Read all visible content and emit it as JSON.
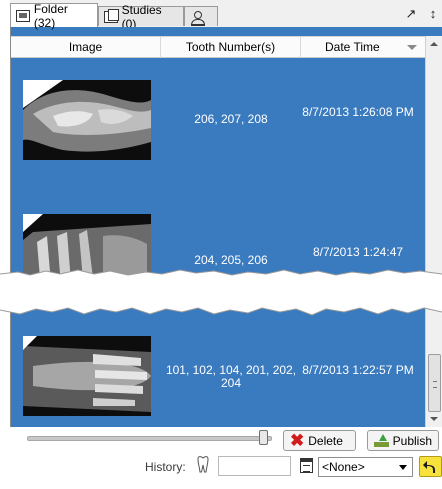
{
  "tabs": [
    {
      "label": "Folder (32)",
      "icon": "folder-icon",
      "active": true
    },
    {
      "label": "Studies (0)",
      "icon": "studies-icon",
      "active": false
    },
    {
      "label": "",
      "icon": "person-icon",
      "active": false
    }
  ],
  "grid": {
    "columns": [
      "Image",
      "Tooth Number(s)",
      "Date Time"
    ],
    "sort_column": "Date Time",
    "sort_direction": "descending",
    "row_color": "#3a7abf",
    "rows": [
      {
        "tooth_numbers": "206, 207, 208",
        "date_time": "8/7/2013 1:26:08 PM"
      },
      {
        "tooth_numbers": "204, 205, 206",
        "date_time": "8/7/2013 1:24:47"
      },
      {
        "tooth_numbers": "101, 102, 104, 201, 202, 204",
        "date_time": "8/7/2013 1:22:57 PM"
      }
    ]
  },
  "controls": {
    "delete_label": "Delete",
    "publish_label": "Publish",
    "history_label": "History:",
    "history_input_value": "",
    "select_value": "<None>",
    "zoom_slider_fraction": 0.96
  },
  "colors": {
    "selection_blue": "#3a7abf",
    "delete_red": "#d21c1c",
    "undo_yellow": "#f7e23b"
  }
}
